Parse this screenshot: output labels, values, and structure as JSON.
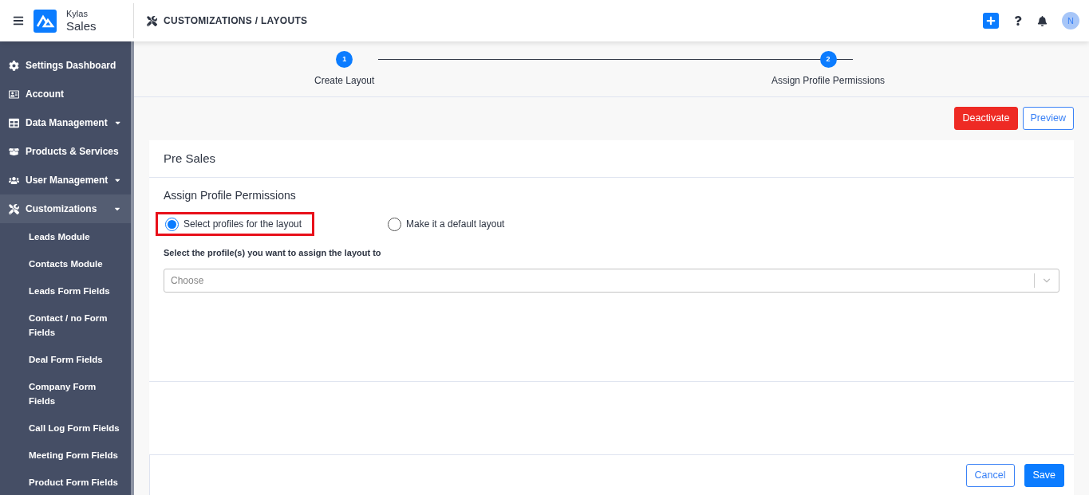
{
  "app": {
    "brand_top": "Kylas",
    "brand_bottom": "Sales"
  },
  "header": {
    "breadcrumb": "CUSTOMIZATIONS / LAYOUTS",
    "avatar": "N"
  },
  "sidebar": {
    "items": [
      {
        "label": "Settings Dashboard",
        "expandable": false,
        "selected": false
      },
      {
        "label": "Account",
        "expandable": false,
        "selected": false
      },
      {
        "label": "Data Management",
        "expandable": true,
        "selected": false
      },
      {
        "label": "Products & Services",
        "expandable": false,
        "selected": false
      },
      {
        "label": "User Management",
        "expandable": true,
        "selected": false
      },
      {
        "label": "Customizations",
        "expandable": true,
        "selected": true,
        "children": [
          {
            "label": "Leads Module"
          },
          {
            "label": "Contacts Module"
          },
          {
            "label": "Leads Form Fields"
          },
          {
            "label": "Contact / no Form Fields"
          },
          {
            "label": "Deal Form Fields"
          },
          {
            "label": "Company Form Fields"
          },
          {
            "label": "Call Log Form Fields"
          },
          {
            "label": "Meeting Form Fields"
          },
          {
            "label": "Product Form Fields"
          }
        ]
      }
    ]
  },
  "steps": [
    {
      "number": "1",
      "label": "Create Layout",
      "active": true
    },
    {
      "number": "2",
      "label": "Assign Profile Permissions",
      "active": true
    }
  ],
  "actions": [
    {
      "label": "Deactivate",
      "kind": "danger"
    },
    {
      "label": "Preview",
      "kind": "outline"
    }
  ],
  "card": {
    "title": "Pre Sales",
    "section_title": "Assign Profile Permissions",
    "options": [
      {
        "label": "Select profiles for the layout",
        "selected": true,
        "highlighted": true
      },
      {
        "label": "Make it a default layout",
        "selected": false,
        "highlighted": false
      }
    ],
    "field_label": "Select the profile(s) you want to assign the layout to",
    "select": {
      "placeholder": "Choose"
    }
  },
  "footer": [
    {
      "label": "Cancel",
      "kind": "outline"
    },
    {
      "label": "Save",
      "kind": "primary"
    }
  ]
}
